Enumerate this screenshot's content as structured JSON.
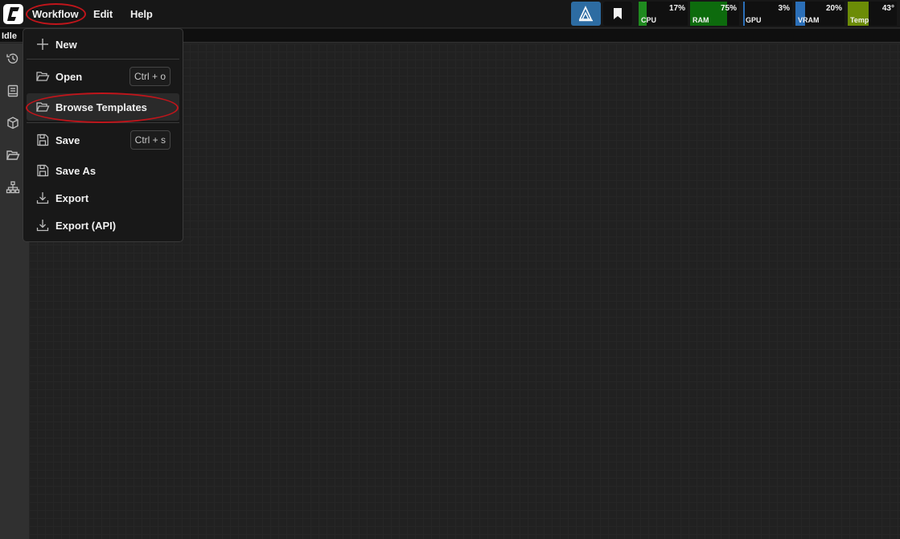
{
  "menubar": {
    "items": [
      {
        "label": "Workflow"
      },
      {
        "label": "Edit"
      },
      {
        "label": "Help"
      }
    ]
  },
  "icons": {
    "logo": "comfyui-logo-icon",
    "queue": "queue-icon",
    "bookmark": "bookmark-icon",
    "history": "history-icon",
    "queue_panel": "book-icon",
    "models": "cube-icon",
    "workflows": "folder-open-icon",
    "node_library": "hierarchy-icon"
  },
  "status": {
    "label": "Idle"
  },
  "monitors": [
    {
      "label": "CPU",
      "value": "17%",
      "level": 0.17,
      "color": "#1f8a1f"
    },
    {
      "label": "RAM",
      "value": "75%",
      "level": 0.75,
      "color": "#0d6b0d"
    },
    {
      "label": "GPU",
      "value": "3%",
      "level": 0.03,
      "color": "#2b6fb8"
    },
    {
      "label": "VRAM",
      "value": "20%",
      "level": 0.2,
      "color": "#2b6fb8"
    },
    {
      "label": "Temp",
      "value": "43°",
      "level": 0.43,
      "color": "#6c8c07"
    }
  ],
  "workflow_menu": {
    "items": [
      {
        "label": "New",
        "icon": "plus-icon",
        "shortcut": ""
      },
      {
        "label": "Open",
        "icon": "folder-open-icon",
        "shortcut": "Ctrl + o"
      },
      {
        "label": "Browse Templates",
        "icon": "folder-open-icon",
        "shortcut": ""
      },
      {
        "label": "Save",
        "icon": "save-icon",
        "shortcut": "Ctrl + s"
      },
      {
        "label": "Save As",
        "icon": "save-icon",
        "shortcut": ""
      },
      {
        "label": "Export",
        "icon": "download-icon",
        "shortcut": ""
      },
      {
        "label": "Export (API)",
        "icon": "download-icon",
        "shortcut": ""
      }
    ]
  },
  "colors": {
    "annotation": "#c0151b",
    "queue_button": "#2d6ca2",
    "menu_bg": "#181818"
  }
}
